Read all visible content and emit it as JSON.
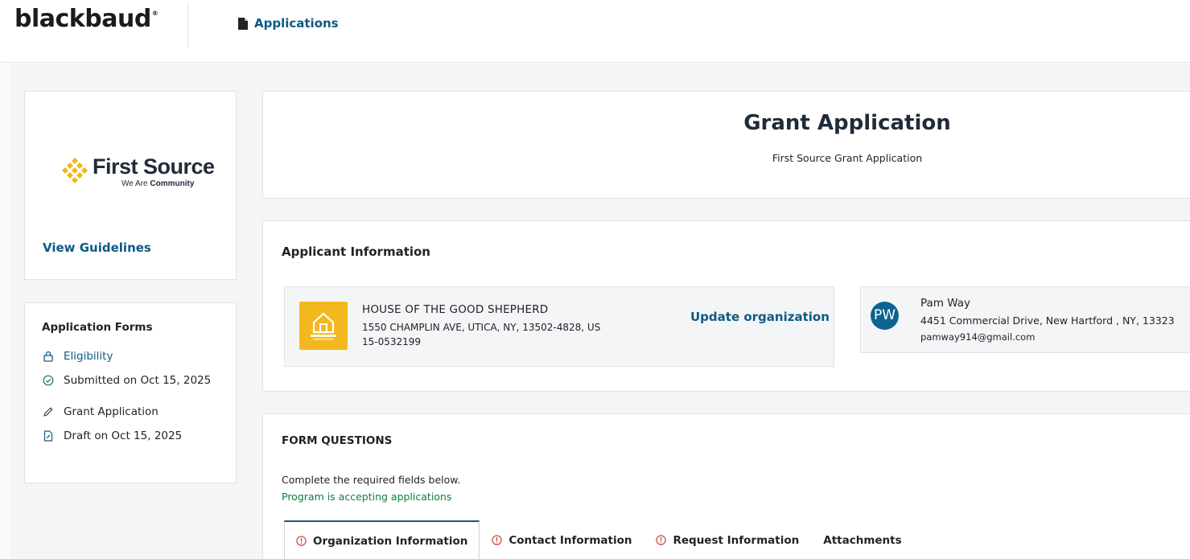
{
  "header": {
    "brand": "blackbaud",
    "brand_mark": "®",
    "nav_label": "Applications",
    "nav_icon": "file-icon"
  },
  "sidebar": {
    "logo": {
      "name": "First Source",
      "tagline_prefix": "We Are",
      "tagline_strong": "Community",
      "colors": {
        "mark": "#f2b51c",
        "text": "#222a3a"
      }
    },
    "view_guidelines": "View Guidelines",
    "forms_title": "Application Forms",
    "forms": [
      {
        "label": "Eligibility",
        "icon": "lock-icon"
      },
      {
        "label": "Submitted on Oct 15, 2025",
        "icon": "check-circle-icon"
      },
      {
        "label": "Grant Application",
        "icon": "pencil-icon"
      },
      {
        "label": "Draft on Oct 15, 2025",
        "icon": "draft-file-icon"
      }
    ]
  },
  "grant": {
    "title": "Grant Application",
    "subtitle": "First Source Grant Application"
  },
  "applicant": {
    "title": "Applicant Information",
    "organization": {
      "name": "HOUSE OF THE GOOD SHEPHERD",
      "address": "1550 CHAMPLIN AVE, UTICA, NY, 13502-4828, US",
      "ein": "15-0532199",
      "update_label": "Update organization"
    },
    "contact": {
      "initials": "PW",
      "name": "Pam Way",
      "address": "4451 Commercial Drive, New Hartford , NY, 13323",
      "email": "pamway914@gmail.com"
    }
  },
  "questions": {
    "title": "FORM QUESTIONS",
    "hint": "Complete the required fields below.",
    "status": "Program is accepting applications",
    "tabs": [
      {
        "label": "Organization Information",
        "warning": true,
        "active": true
      },
      {
        "label": "Contact Information",
        "warning": true,
        "active": false
      },
      {
        "label": "Request Information",
        "warning": true,
        "active": false
      },
      {
        "label": "Attachments",
        "warning": false,
        "active": false
      }
    ]
  },
  "colors": {
    "link": "#0d5a85",
    "success": "#0e7d3e",
    "warning": "#c0392b",
    "avatar": "#0d6391",
    "org_logo": "#f3b81d"
  }
}
